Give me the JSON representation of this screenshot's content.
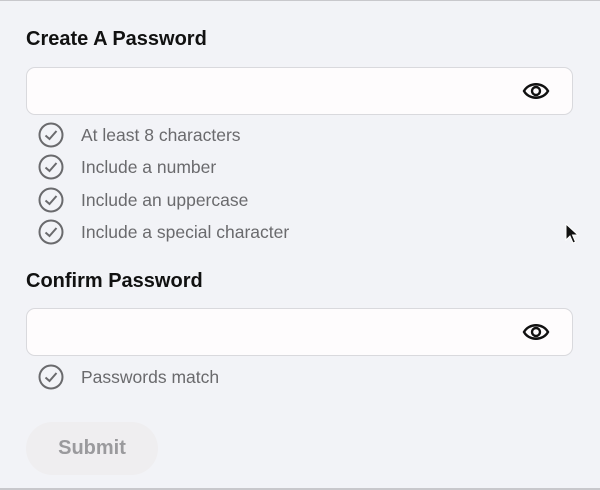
{
  "create": {
    "title": "Create A Password",
    "value": "",
    "requirements": [
      "At least 8 characters",
      "Include a number",
      "Include an uppercase",
      "Include a special character"
    ]
  },
  "confirm": {
    "title": "Confirm Password",
    "value": "",
    "requirements": [
      "Passwords match"
    ]
  },
  "submit_label": "Submit",
  "colors": {
    "background": "#f2f3f7",
    "requirement_text": "#6a6a6d",
    "button_bg": "#efeef0"
  }
}
